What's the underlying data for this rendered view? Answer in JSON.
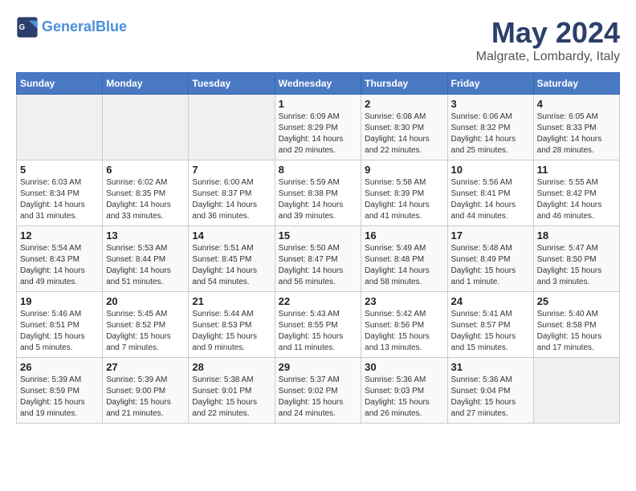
{
  "header": {
    "logo_line1": "General",
    "logo_line2": "Blue",
    "month": "May 2024",
    "location": "Malgrate, Lombardy, Italy"
  },
  "weekdays": [
    "Sunday",
    "Monday",
    "Tuesday",
    "Wednesday",
    "Thursday",
    "Friday",
    "Saturday"
  ],
  "weeks": [
    [
      {
        "day": "",
        "content": ""
      },
      {
        "day": "",
        "content": ""
      },
      {
        "day": "",
        "content": ""
      },
      {
        "day": "1",
        "content": "Sunrise: 6:09 AM\nSunset: 8:29 PM\nDaylight: 14 hours\nand 20 minutes."
      },
      {
        "day": "2",
        "content": "Sunrise: 6:08 AM\nSunset: 8:30 PM\nDaylight: 14 hours\nand 22 minutes."
      },
      {
        "day": "3",
        "content": "Sunrise: 6:06 AM\nSunset: 8:32 PM\nDaylight: 14 hours\nand 25 minutes."
      },
      {
        "day": "4",
        "content": "Sunrise: 6:05 AM\nSunset: 8:33 PM\nDaylight: 14 hours\nand 28 minutes."
      }
    ],
    [
      {
        "day": "5",
        "content": "Sunrise: 6:03 AM\nSunset: 8:34 PM\nDaylight: 14 hours\nand 31 minutes."
      },
      {
        "day": "6",
        "content": "Sunrise: 6:02 AM\nSunset: 8:35 PM\nDaylight: 14 hours\nand 33 minutes."
      },
      {
        "day": "7",
        "content": "Sunrise: 6:00 AM\nSunset: 8:37 PM\nDaylight: 14 hours\nand 36 minutes."
      },
      {
        "day": "8",
        "content": "Sunrise: 5:59 AM\nSunset: 8:38 PM\nDaylight: 14 hours\nand 39 minutes."
      },
      {
        "day": "9",
        "content": "Sunrise: 5:58 AM\nSunset: 8:39 PM\nDaylight: 14 hours\nand 41 minutes."
      },
      {
        "day": "10",
        "content": "Sunrise: 5:56 AM\nSunset: 8:41 PM\nDaylight: 14 hours\nand 44 minutes."
      },
      {
        "day": "11",
        "content": "Sunrise: 5:55 AM\nSunset: 8:42 PM\nDaylight: 14 hours\nand 46 minutes."
      }
    ],
    [
      {
        "day": "12",
        "content": "Sunrise: 5:54 AM\nSunset: 8:43 PM\nDaylight: 14 hours\nand 49 minutes."
      },
      {
        "day": "13",
        "content": "Sunrise: 5:53 AM\nSunset: 8:44 PM\nDaylight: 14 hours\nand 51 minutes."
      },
      {
        "day": "14",
        "content": "Sunrise: 5:51 AM\nSunset: 8:45 PM\nDaylight: 14 hours\nand 54 minutes."
      },
      {
        "day": "15",
        "content": "Sunrise: 5:50 AM\nSunset: 8:47 PM\nDaylight: 14 hours\nand 56 minutes."
      },
      {
        "day": "16",
        "content": "Sunrise: 5:49 AM\nSunset: 8:48 PM\nDaylight: 14 hours\nand 58 minutes."
      },
      {
        "day": "17",
        "content": "Sunrise: 5:48 AM\nSunset: 8:49 PM\nDaylight: 15 hours\nand 1 minute."
      },
      {
        "day": "18",
        "content": "Sunrise: 5:47 AM\nSunset: 8:50 PM\nDaylight: 15 hours\nand 3 minutes."
      }
    ],
    [
      {
        "day": "19",
        "content": "Sunrise: 5:46 AM\nSunset: 8:51 PM\nDaylight: 15 hours\nand 5 minutes."
      },
      {
        "day": "20",
        "content": "Sunrise: 5:45 AM\nSunset: 8:52 PM\nDaylight: 15 hours\nand 7 minutes."
      },
      {
        "day": "21",
        "content": "Sunrise: 5:44 AM\nSunset: 8:53 PM\nDaylight: 15 hours\nand 9 minutes."
      },
      {
        "day": "22",
        "content": "Sunrise: 5:43 AM\nSunset: 8:55 PM\nDaylight: 15 hours\nand 11 minutes."
      },
      {
        "day": "23",
        "content": "Sunrise: 5:42 AM\nSunset: 8:56 PM\nDaylight: 15 hours\nand 13 minutes."
      },
      {
        "day": "24",
        "content": "Sunrise: 5:41 AM\nSunset: 8:57 PM\nDaylight: 15 hours\nand 15 minutes."
      },
      {
        "day": "25",
        "content": "Sunrise: 5:40 AM\nSunset: 8:58 PM\nDaylight: 15 hours\nand 17 minutes."
      }
    ],
    [
      {
        "day": "26",
        "content": "Sunrise: 5:39 AM\nSunset: 8:59 PM\nDaylight: 15 hours\nand 19 minutes."
      },
      {
        "day": "27",
        "content": "Sunrise: 5:39 AM\nSunset: 9:00 PM\nDaylight: 15 hours\nand 21 minutes."
      },
      {
        "day": "28",
        "content": "Sunrise: 5:38 AM\nSunset: 9:01 PM\nDaylight: 15 hours\nand 22 minutes."
      },
      {
        "day": "29",
        "content": "Sunrise: 5:37 AM\nSunset: 9:02 PM\nDaylight: 15 hours\nand 24 minutes."
      },
      {
        "day": "30",
        "content": "Sunrise: 5:36 AM\nSunset: 9:03 PM\nDaylight: 15 hours\nand 26 minutes."
      },
      {
        "day": "31",
        "content": "Sunrise: 5:36 AM\nSunset: 9:04 PM\nDaylight: 15 hours\nand 27 minutes."
      },
      {
        "day": "",
        "content": ""
      }
    ]
  ]
}
